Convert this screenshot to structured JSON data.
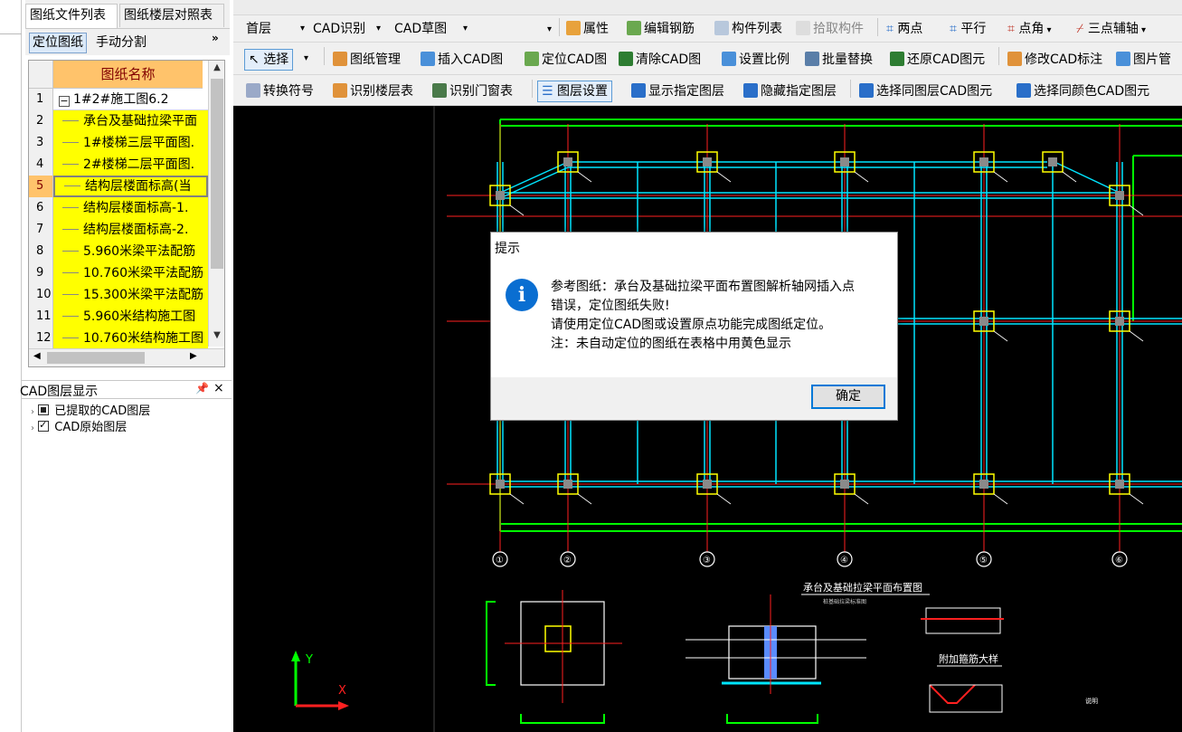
{
  "left_panel": {
    "tabs": [
      "图纸文件列表",
      "图纸楼层对照表"
    ],
    "buttons": {
      "locate": "定位图纸",
      "split": "手动分割",
      "more": "»"
    },
    "grid": {
      "header": "图纸名称",
      "rows": [
        {
          "num": "1",
          "name": "1#2#施工图6.2",
          "toggle": "−"
        },
        {
          "num": "2",
          "name": "承台及基础拉梁平面"
        },
        {
          "num": "3",
          "name": "1#楼梯三层平面图."
        },
        {
          "num": "4",
          "name": "2#楼梯二层平面图."
        },
        {
          "num": "5",
          "name": "结构层楼面标高(当"
        },
        {
          "num": "6",
          "name": "结构层楼面标高-1."
        },
        {
          "num": "7",
          "name": "结构层楼面标高-2."
        },
        {
          "num": "8",
          "name": "5.960米梁平法配筋"
        },
        {
          "num": "9",
          "name": "10.760米梁平法配筋"
        },
        {
          "num": "10",
          "name": "15.300米梁平法配筋"
        },
        {
          "num": "11",
          "name": "5.960米结构施工图"
        },
        {
          "num": "12",
          "name": "10.760米结构施工图"
        }
      ]
    },
    "layers": {
      "title": "CAD图层显示",
      "pin": "ᵩ",
      "close": "×",
      "items": [
        "已提取的CAD图层",
        "CAD原始图层"
      ]
    }
  },
  "toolbar_row1": {
    "floor": "首层",
    "mode": "CAD识别",
    "drawing": "CAD草图",
    "tools": [
      "属性",
      "编辑钢筋",
      "构件列表",
      "拾取构件",
      "两点",
      "平行",
      "点角",
      "三点辅轴"
    ]
  },
  "toolbar_row2": {
    "select": "选择",
    "tools": [
      "图纸管理",
      "插入CAD图",
      "定位CAD图",
      "清除CAD图",
      "设置比例",
      "批量替换",
      "还原CAD图元",
      "修改CAD标注",
      "图片管"
    ]
  },
  "toolbar_row3": {
    "tools": [
      "转换符号",
      "识别楼层表",
      "识别门窗表",
      "图层设置",
      "显示指定图层",
      "隐藏指定图层",
      "选择同图层CAD图元",
      "选择同颜色CAD图元"
    ]
  },
  "canvas": {
    "title": "承台及基础拉梁平面布置图",
    "subtitle": "桩基础拉梁标准图",
    "detail_title": "附加箍筋大样",
    "notes_title": "说明",
    "axis_labels": [
      "①",
      "②",
      "③",
      "④",
      "⑤",
      "⑥"
    ],
    "ucs_y": "Y",
    "ucs_x": "X",
    "colors": {
      "grid": "#00ff00",
      "beam": "#00e5ff",
      "axis": "#ff2020",
      "column": "#ffff00",
      "bg": "#000000"
    }
  },
  "dialog": {
    "title": "提示",
    "icon": "i",
    "lines": [
      "参考图纸：承台及基础拉梁平面布置图解析轴网插入点",
      "错误，定位图纸失败!",
      "请使用定位CAD图或设置原点功能完成图纸定位。",
      "注：未自动定位的图纸在表格中用黄色显示"
    ],
    "ok": "确定"
  }
}
